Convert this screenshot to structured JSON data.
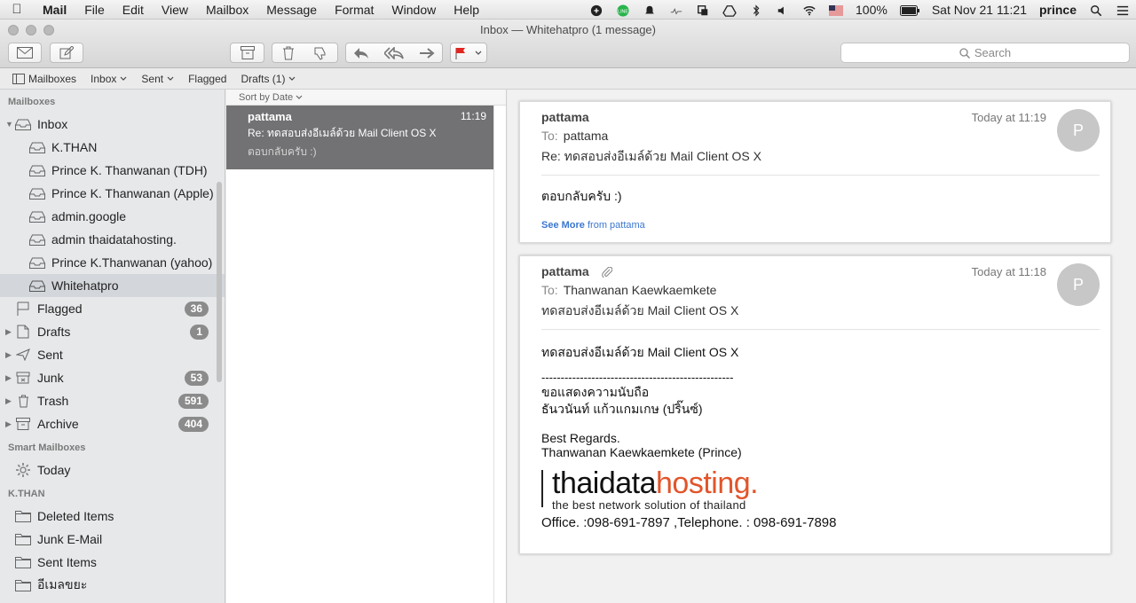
{
  "menubar": {
    "app": "Mail",
    "items": [
      "File",
      "Edit",
      "View",
      "Mailbox",
      "Message",
      "Format",
      "Window",
      "Help"
    ],
    "battery": "100%",
    "datetime": "Sat Nov 21  11:21",
    "user": "prince"
  },
  "window": {
    "title": "Inbox — Whitehatpro (1 message)",
    "search_placeholder": "Search"
  },
  "favorites": {
    "mailboxes": "Mailboxes",
    "inbox": "Inbox",
    "sent": "Sent",
    "flagged": "Flagged",
    "drafts": "Drafts (1)"
  },
  "sidebar": {
    "mailboxes_header": "Mailboxes",
    "inbox": "Inbox",
    "accounts": [
      "K.THAN",
      "Prince K. Thanwanan (TDH)",
      "Prince K. Thanwanan (Apple)",
      "admin.google",
      "admin thaidatahosting.",
      "Prince K.Thanwanan (yahoo)",
      "Whitehatpro"
    ],
    "folders": [
      {
        "label": "Flagged",
        "badge": "36"
      },
      {
        "label": "Drafts",
        "badge": "1"
      },
      {
        "label": "Sent",
        "badge": ""
      },
      {
        "label": "Junk",
        "badge": "53"
      },
      {
        "label": "Trash",
        "badge": "591"
      },
      {
        "label": "Archive",
        "badge": "404"
      }
    ],
    "smart_header": "Smart Mailboxes",
    "smart_today": "Today",
    "kthan_header": "K.THAN",
    "kthan_folders": [
      "Deleted Items",
      "Junk E-Mail",
      "Sent Items",
      "อีเมลขยะ"
    ]
  },
  "messagelist": {
    "sort": "Sort by Date",
    "item": {
      "from": "pattama",
      "time": "11:19",
      "subject": "Re: ทดสอบส่งอีเมล์ด้วย Mail Client OS X",
      "preview": "ตอบกลับครับ :)"
    }
  },
  "messages": [
    {
      "from": "pattama",
      "date": "Today at 11:19",
      "to_label": "To:",
      "to": "pattama",
      "subject": "Re: ทดสอบส่งอีเมล์ด้วย Mail Client OS X",
      "body": "ตอบกลับครับ :)",
      "see_more": "See More",
      "see_more_from": "from pattama",
      "avatar": "P"
    },
    {
      "from": "pattama",
      "date": "Today at 11:18",
      "to_label": "To:",
      "to": "Thanwanan Kaewkaemkete",
      "subject": "ทดสอบส่งอีเมล์ด้วย Mail Client OS X",
      "avatar": "P",
      "body_lines": [
        "ทดสอบส่งอีเมล์ด้วย Mail Client OS X",
        "--------------------------------------------------",
        "ขอแสดงความนับถือ",
        "ธันวนันท์ แก้วแกมเกษ (ปริ๊นซ์)",
        "Best Regards.",
        "Thanwanan Kaewkaemkete (Prince)"
      ],
      "logo_thai": "thai",
      "logo_data": "data",
      "logo_hosting": "hosting.",
      "logo_tagline": "the best network solution of thailand",
      "contact": "Office. :098-691-7897 ,Telephone. : 098-691-7898"
    }
  ]
}
